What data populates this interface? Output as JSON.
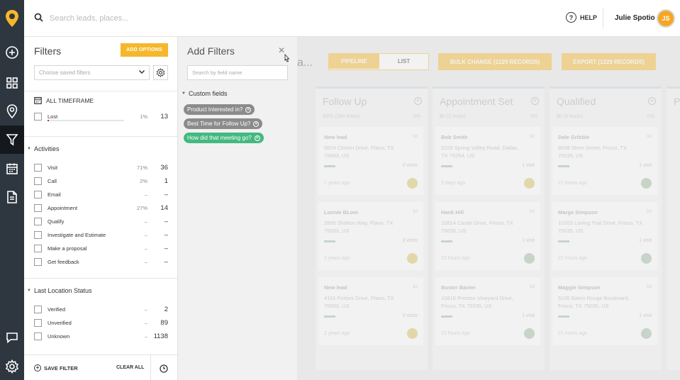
{
  "topbar": {
    "search_placeholder": "Search leads, places...",
    "help_label": "HELP",
    "user_name": "Julie Spotio",
    "avatar_initials": "JS"
  },
  "colors": {
    "accent": "#f5b72b",
    "rail": "#2e3740",
    "chip_grey": "#8b8b8b",
    "chip_green": "#43b97f"
  },
  "rail_icons": [
    "logo-pin-icon",
    "add-circle-icon",
    "dashboard-grid-icon",
    "map-pin-icon",
    "filter-icon",
    "calendar-icon",
    "document-icon",
    "chat-icon",
    "settings-gear-icon"
  ],
  "filters": {
    "title": "Filters",
    "add_options": "ADD OPTIONS",
    "saved_placeholder": "Choose saved filters",
    "timeframe": "ALL TIMEFRAME",
    "lost": {
      "label": "Lost",
      "pct": "1%",
      "count": "13",
      "progress": 0.01
    },
    "activities_title": "Activities",
    "activities": [
      {
        "label": "Visit",
        "pct": "71%",
        "count": "36"
      },
      {
        "label": "Call",
        "pct": "2%",
        "count": "1"
      },
      {
        "label": "Email",
        "pct": "–",
        "count": "–"
      },
      {
        "label": "Appointment",
        "pct": "27%",
        "count": "14"
      },
      {
        "label": "Qualify",
        "pct": "–",
        "count": "–"
      },
      {
        "label": "Investigate and Estimate",
        "pct": "–",
        "count": "–"
      },
      {
        "label": "Make a proposal",
        "pct": "–",
        "count": "–"
      },
      {
        "label": "Get feedback",
        "pct": "–",
        "count": "–"
      }
    ],
    "location_title": "Last Location Status",
    "location": [
      {
        "label": "Verified",
        "pct": "–",
        "count": "2"
      },
      {
        "label": "Unverified",
        "pct": "–",
        "count": "89"
      },
      {
        "label": "Unknown",
        "pct": "–",
        "count": "1138"
      }
    ],
    "save_filter": "SAVE FILTER",
    "clear_all": "CLEAR ALL"
  },
  "add_filters": {
    "title": "Add Filters",
    "search_placeholder": "Search by field name",
    "custom_fields_title": "Custom fields",
    "chips": [
      {
        "label": "Product Interested in?",
        "state": "grey"
      },
      {
        "label": "Best Time for Follow Up?",
        "state": "grey"
      },
      {
        "label": "How did that meeting go?",
        "state": "green"
      }
    ]
  },
  "board": {
    "title_fragment": "a...",
    "view_toggle": [
      "PIPELINE",
      "LIST"
    ],
    "bulk_change": "BULK CHANGE (1229 RECORDS)",
    "export": "EXPORT (1229 RECORDS)",
    "columns": [
      {
        "title": "Follow Up",
        "sub": "8355 (264 leads)",
        "pct": "6%",
        "cards": [
          {
            "name": "New lead",
            "days": "3d",
            "addr": "5624 Clinton Drive, Plano, TX 75093, US",
            "visits": "0 visits",
            "ago": "2 years ago",
            "dot": "y"
          },
          {
            "name": "Lonnie BLom",
            "days": "3d",
            "addr": "2805 Shelton Way, Plano, TX 75093, US",
            "visits": "0 visits",
            "ago": "2 years ago",
            "dot": "y"
          },
          {
            "name": "New lead",
            "days": "3d",
            "addr": "4101 Forbes Drive, Plano, TX 75093, US",
            "visits": "0 visits",
            "ago": "2 years ago",
            "dot": "y"
          }
        ]
      },
      {
        "title": "Appointment Set",
        "sub": "$0 (3 leads)",
        "pct": "0%",
        "cards": [
          {
            "name": "Bob Smith",
            "days": "3d",
            "addr": "5229 Spring Valley Road, Dallas, TX 75254, US",
            "visits": "1 visit",
            "ago": "3 days ago",
            "dot": "y"
          },
          {
            "name": "Hank Hill",
            "days": "3d",
            "addr": "10814 Castle Drive, Frisco, TX 75035, US",
            "visits": "1 visit",
            "ago": "23 hours ago",
            "dot": ""
          },
          {
            "name": "Buster Baxter",
            "days": "3d",
            "addr": "10816 Preston Vineyard Drive, Frisco, TX 75035, US",
            "visits": "1 visit",
            "ago": "23 hours ago",
            "dot": ""
          }
        ]
      },
      {
        "title": "Qualified",
        "sub": "$0 (6 leads)",
        "pct": "0%",
        "cards": [
          {
            "name": "Dale Gribble",
            "days": "3d",
            "addr": "8508 Stern Street, Frisco, TX 75035, US",
            "visits": "1 visit",
            "ago": "21 hours ago",
            "dot": ""
          },
          {
            "name": "Marge Simpson",
            "days": "3d",
            "addr": "10203 Loving Trail Drive, Frisco, TX 75035, US",
            "visits": "1 visit",
            "ago": "21 hours ago",
            "dot": ""
          },
          {
            "name": "Maggie Simpson",
            "days": "3d",
            "addr": "5235 Baton Rouge Boulevard, Frisco, TX 75035, US",
            "visits": "1 visit",
            "ago": "21 hours ago",
            "dot": ""
          }
        ]
      },
      {
        "title": "P",
        "sub": "",
        "pct": "",
        "cards": []
      }
    ]
  }
}
